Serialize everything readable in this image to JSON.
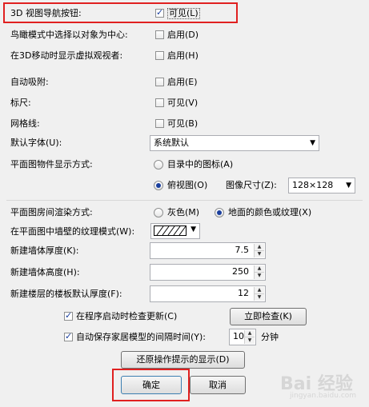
{
  "rows": {
    "nav_buttons": {
      "label": "3D 视图导航按钮:",
      "option": "可见(L)",
      "checked": true
    },
    "aerial_center": {
      "label": "鸟瞰模式中选择以对象为中心:",
      "option": "启用(D)",
      "checked": false
    },
    "virtual_viewer": {
      "label": "在3D移动时显示虚拟观视者:",
      "option": "启用(H)",
      "checked": false
    },
    "auto_snap": {
      "label": "自动吸附:",
      "option": "启用(E)",
      "checked": false
    },
    "ruler": {
      "label": "标尺:",
      "option": "可见(V)",
      "checked": false
    },
    "grid": {
      "label": "网格线:",
      "option": "可见(B)",
      "checked": false
    }
  },
  "default_font": {
    "label": "默认字体(U):",
    "value": "系统默认"
  },
  "plan_display": {
    "label": "平面图物件显示方式:",
    "option_catalog": "目录中的图标(A)",
    "option_top": "俯视图(O)",
    "icon_size_label": "图像尺寸(Z):",
    "icon_size_value": "128×128"
  },
  "room_render": {
    "label": "平面图房间渲染方式:",
    "option_gray": "灰色(M)",
    "option_floor": "地面的颜色或纹理(X)"
  },
  "wall_pattern": {
    "label": "在平面图中墙壁的纹理模式(W):"
  },
  "wall_thickness": {
    "label": "新建墙体厚度(K):",
    "value": "7.5"
  },
  "wall_height": {
    "label": "新建墙体高度(H):",
    "value": "250"
  },
  "floor_thickness": {
    "label": "新建楼层的楼板默认厚度(F):",
    "value": "12"
  },
  "check_updates": {
    "label": "在程序启动时检查更新(C)",
    "checked": true,
    "button": "立即检查(K)"
  },
  "auto_save": {
    "label": "自动保存家居模型的间隔时间(Y):",
    "checked": true,
    "value": "10",
    "unit": "分钟"
  },
  "restore_tips": {
    "label": "还原操作提示的显示(D)"
  },
  "ok": {
    "label": "确定"
  },
  "cancel": {
    "label": "取消"
  },
  "watermark": {
    "text": "Bai  经验",
    "sub": "jingyan.baidu.com"
  },
  "colors": {
    "highlight": "#e02020",
    "accent": "#1a3f9e"
  }
}
